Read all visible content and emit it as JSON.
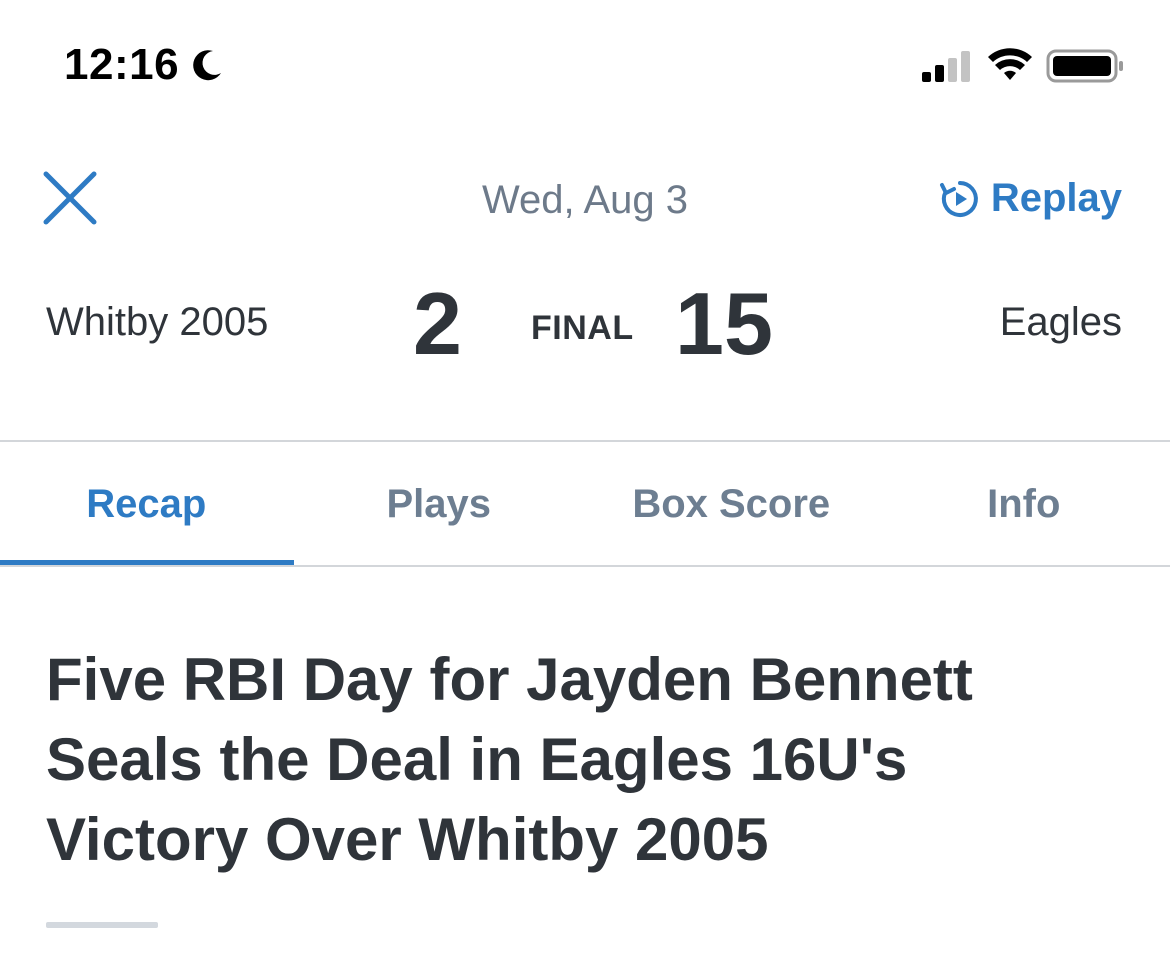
{
  "status_bar": {
    "time": "12:16",
    "icons": [
      "moon-icon",
      "signal-icon",
      "wifi-icon",
      "battery-icon"
    ]
  },
  "header": {
    "close_icon": "close-icon",
    "date": "Wed, Aug 3",
    "replay_label": "Replay",
    "replay_icon": "replay-icon"
  },
  "scoreboard": {
    "away_team": "Whitby 2005",
    "away_score": "2",
    "status": "FINAL",
    "home_score": "15",
    "home_team": "Eagles"
  },
  "tabs": [
    {
      "label": "Recap",
      "active": true
    },
    {
      "label": "Plays",
      "active": false
    },
    {
      "label": "Box Score",
      "active": false
    },
    {
      "label": "Info",
      "active": false
    }
  ],
  "article": {
    "headline": "Five RBI Day for Jayden Bennett Seals the Deal in Eagles 16U's Victory Over Whitby 2005"
  },
  "colors": {
    "accent": "#2e7bc4",
    "text": "#2f343a",
    "muted": "#6d7e91",
    "divider": "#d3d6da"
  }
}
